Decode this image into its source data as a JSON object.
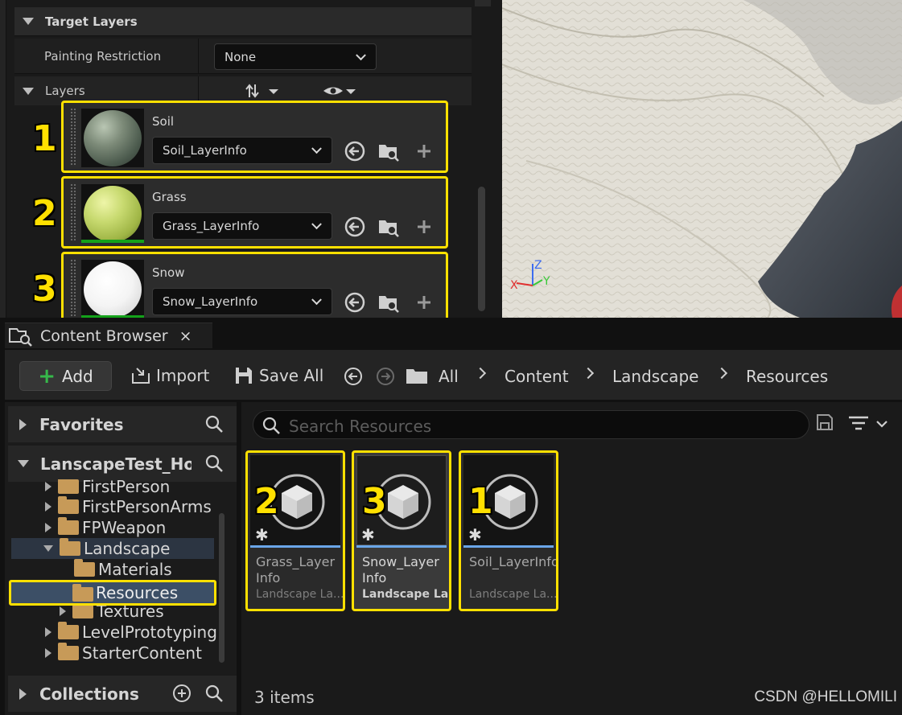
{
  "details": {
    "target_layers_title": "Target Layers",
    "painting_restriction_label": "Painting Restriction",
    "painting_restriction_value": "None",
    "layers_title": "Layers",
    "layers": [
      {
        "number": "1",
        "name": "Soil",
        "info": "Soil_LayerInfo",
        "color": "#5c6b5a"
      },
      {
        "number": "2",
        "name": "Grass",
        "info": "Grass_LayerInfo",
        "color": "#b8d064"
      },
      {
        "number": "3",
        "name": "Snow",
        "info": "Snow_LayerInfo",
        "color": "#f2f2f2"
      }
    ]
  },
  "viewport": {
    "axis_z": "Z",
    "axis_y": "Y",
    "axis_x": "X"
  },
  "content_browser": {
    "tab_title": "Content Browser",
    "tab_close": "×",
    "toolbar": {
      "add_label": "Add",
      "import_label": "Import",
      "save_all_label": "Save All"
    },
    "breadcrumbs": [
      "All",
      "Content",
      "Landscape",
      "Resources"
    ],
    "sources": {
      "favorites_title": "Favorites",
      "project_title": "LanscapeTest_Hon",
      "collections_title": "Collections",
      "tree": [
        "FirstPerson",
        "FirstPersonArms",
        "FPWeapon",
        "Landscape",
        "Materials",
        "Resources",
        "Textures",
        "LevelPrototyping",
        "StarterContent"
      ]
    },
    "search_placeholder": "Search Resources",
    "assets": [
      {
        "number": "2",
        "name": "Grass_Layer Info",
        "type": "Landscape La..."
      },
      {
        "number": "3",
        "name": "Snow_Layer Info",
        "type": "Landscape La..."
      },
      {
        "number": "1",
        "name": "Soil_LayerInfo",
        "type": "Landscape La..."
      }
    ],
    "item_count": "3 items",
    "watermark": "CSDN @HELLOMILI"
  },
  "colors": {
    "highlight": "#ffe000",
    "add_green": "#36b94a",
    "selection": "#3c4f66",
    "accent_blue": "#6aa6e8"
  }
}
